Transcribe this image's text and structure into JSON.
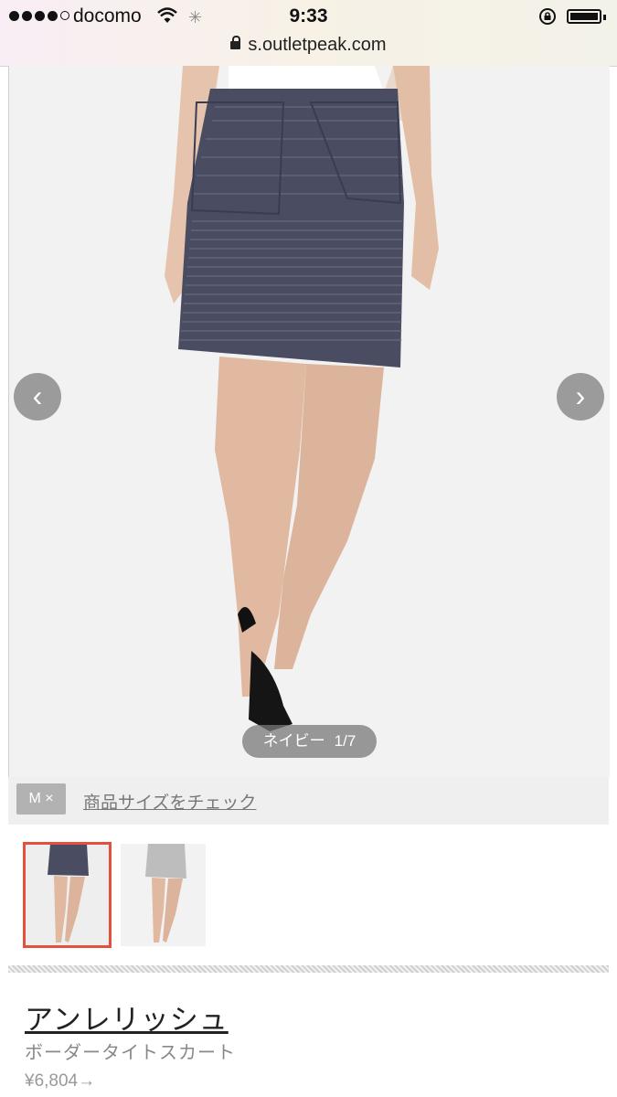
{
  "status_bar": {
    "carrier": "docomo",
    "time": "9:33"
  },
  "browser": {
    "url": "s.outletpeak.com"
  },
  "gallery": {
    "prev_label": "‹",
    "next_label": "›",
    "color_name": "ネイビー",
    "counter": "1/7"
  },
  "size": {
    "selected": "M ×",
    "check_link": "商品サイズをチェック"
  },
  "product": {
    "brand": "アンレリッシュ",
    "name": "ボーダータイトスカート",
    "price": "¥6,804→"
  },
  "colors": {
    "selected_border": "#e2503e",
    "skirt": "#4a4c62"
  }
}
